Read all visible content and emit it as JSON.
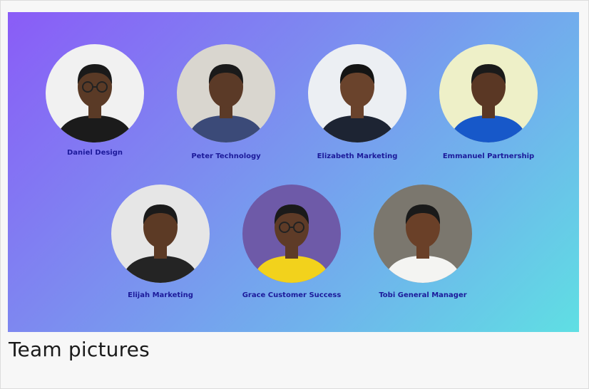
{
  "team": [
    {
      "name": "Daniel Design",
      "photo": {
        "bg": "#f1f1f1",
        "skin": "#5a3a26",
        "shirt": "#1b1b1b",
        "hair": "#1a1a1a",
        "glasses": true
      }
    },
    {
      "name": "Peter Technology",
      "photo": {
        "bg": "#d9d6cf",
        "skin": "#5b3a27",
        "shirt": "#3b4a78",
        "hair": "#1a1a1a",
        "glasses": false
      }
    },
    {
      "name": "Elizabeth Marketing",
      "photo": {
        "bg": "#eceff3",
        "skin": "#6a432c",
        "shirt": "#1d2433",
        "hair": "#141414",
        "glasses": false
      }
    },
    {
      "name": "Emmanuel Partnership",
      "photo": {
        "bg": "#eef0c8",
        "skin": "#5a3724",
        "shirt": "#1758c9",
        "hair": "#1a1a1a",
        "glasses": false
      }
    },
    {
      "name": "Elijah Marketing",
      "photo": {
        "bg": "#e6e6e6",
        "skin": "#5c3a25",
        "shirt": "#242424",
        "hair": "#1a1a1a",
        "glasses": false
      }
    },
    {
      "name": "Grace Customer Success",
      "photo": {
        "bg": "#6e5aa8",
        "skin": "#5e3b27",
        "shirt": "#f2d21c",
        "hair": "#1a1a1a",
        "glasses": true
      }
    },
    {
      "name": "Tobi General Manager",
      "photo": {
        "bg": "#7b776e",
        "skin": "#6a4028",
        "shirt": "#f4f4f2",
        "hair": "#1a1a1a",
        "glasses": false
      }
    }
  ],
  "caption": "Team pictures"
}
